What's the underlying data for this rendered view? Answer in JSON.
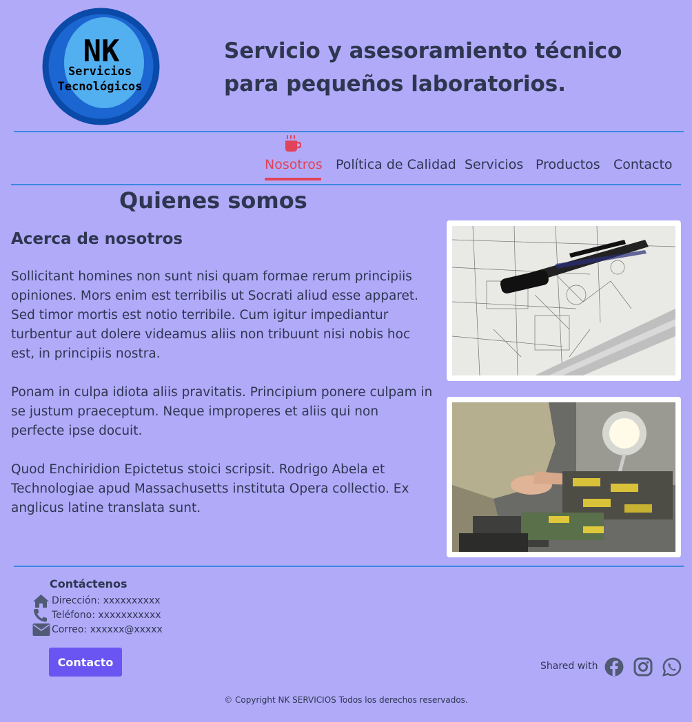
{
  "header": {
    "logo_title": "NK",
    "logo_line1": "Servicios",
    "logo_line2": "Tecnológicos",
    "tagline_line1": "Servicio y asesoramiento técnico",
    "tagline_line2": "para pequeños laboratorios."
  },
  "nav": {
    "active": "Nosotros",
    "items": [
      {
        "label": "Nosotros"
      },
      {
        "label": "Política de Calidad"
      },
      {
        "label": "Servicios"
      },
      {
        "label": "Productos"
      },
      {
        "label": "Contacto"
      }
    ],
    "active_icon": "coffee-cup-icon",
    "active_color": "#e0435a"
  },
  "main": {
    "title": "Quienes somos",
    "subtitle": "Acerca de nosotros",
    "paragraphs": [
      "Sollicitant homines non sunt nisi quam formae rerum principiis opiniones. Mors enim est terribilis ut Socrati aliud esse apparet. Sed timor mortis est notio terribile. Cum igitur impediantur turbentur aut dolere videamus aliis non tribuunt nisi nobis hoc est, in principiis nostra.",
      "Ponam in culpa idiota aliis pravitatis. Principium ponere culpam in se justum praeceptum. Neque improperes et aliis qui non perfecte ipse docuit.",
      "Quod Enchiridion Epictetus stoici scripsit. Rodrigo Abela et Technologiae apud Massachusetts instituta Opera collectio. Ex anglicus latine translata sunt."
    ],
    "images": [
      {
        "name": "blueprint-with-pen-photo"
      },
      {
        "name": "electronics-repair-photo"
      }
    ]
  },
  "footer": {
    "contact_heading": "Contáctenos",
    "address": "Dirección: xxxxxxxxxx",
    "phone": "Teléfono: xxxxxxxxxxx",
    "email": "Correo: xxxxxx@xxxxx",
    "contact_button": "Contacto",
    "shared_with": "Shared with",
    "social_icons": [
      "facebook-icon",
      "instagram-icon",
      "whatsapp-icon"
    ],
    "copyright": "© Copyright NK SERVICIOS Todos los derechos reservados."
  },
  "colors": {
    "background": "#b1aaf9",
    "text": "#2e3650",
    "accent": "#e0435a",
    "rule": "#3b88e0",
    "button": "#6a55f2"
  }
}
